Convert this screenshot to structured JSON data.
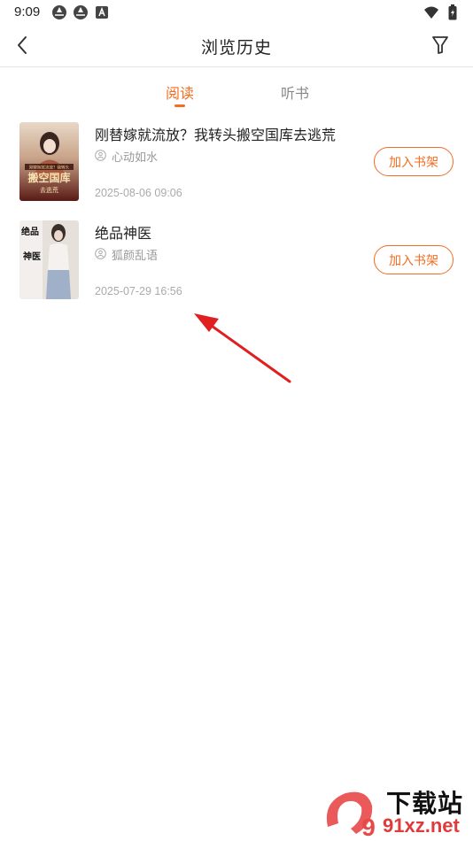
{
  "status_bar": {
    "time": "9:09",
    "icons_left": [
      "aperture-icon",
      "aperture-icon",
      "a-badge-icon"
    ],
    "icons_right": [
      "wifi-icon",
      "battery-icon"
    ]
  },
  "header": {
    "title": "浏览历史",
    "back_icon": "chevron-left-icon",
    "filter_icon": "filter-icon"
  },
  "tabs": [
    {
      "label": "阅读",
      "active": true
    },
    {
      "label": "听书",
      "active": false
    }
  ],
  "books": [
    {
      "title": "刚替嫁就流放？我转头搬空国库去逃荒",
      "author": "心动如水",
      "read_time": "2025-08-06 09:06",
      "button_label": "加入书架",
      "cover_text": [
        "刚替嫁就流放？我转头",
        "搬空国库",
        "去逃荒"
      ]
    },
    {
      "title": "绝品神医",
      "author": "狐颜乱语",
      "read_time": "2025-07-29 16:56",
      "button_label": "加入书架",
      "cover_text": [
        "绝品",
        "神医"
      ]
    }
  ],
  "watermark": {
    "logo_text": "9",
    "name": "下载站",
    "url": "91xz.net"
  },
  "colors": {
    "accent": "#f26d21",
    "annotation_arrow": "#e02020",
    "watermark_red": "#e03b3b"
  }
}
